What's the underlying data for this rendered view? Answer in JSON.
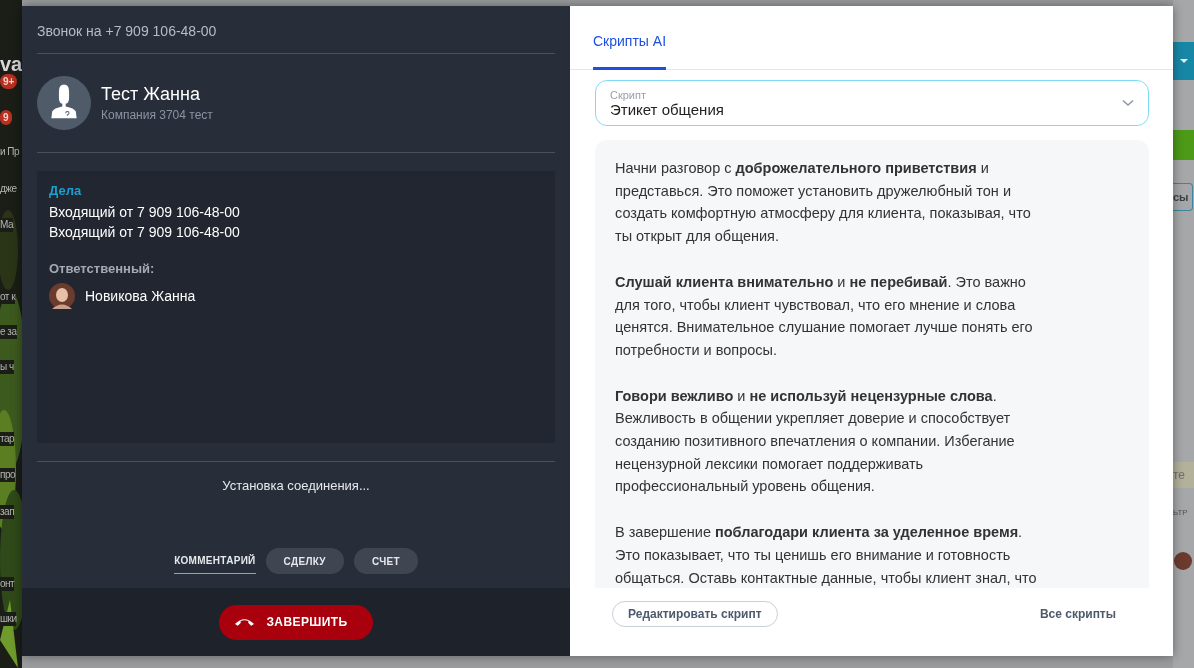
{
  "background": {
    "left": [
      {
        "kind": "logo",
        "text": "va"
      },
      {
        "kind": "badge",
        "text": "9+"
      },
      {
        "kind": "badge",
        "text": "9"
      },
      {
        "kind": "text",
        "text": "и Пр"
      },
      {
        "kind": "text",
        "text": "дже"
      },
      {
        "kind": "text",
        "text": "Ма"
      },
      {
        "kind": "text",
        "text": "от к"
      },
      {
        "kind": "text",
        "text": "е за"
      },
      {
        "kind": "text",
        "text": "ы ч"
      },
      {
        "kind": "text",
        "text": "тар"
      },
      {
        "kind": "text",
        "text": "про"
      },
      {
        "kind": "text",
        "text": "зап"
      },
      {
        "kind": "text",
        "text": "онт"
      },
      {
        "kind": "text",
        "text": "шки"
      }
    ],
    "right": [
      {
        "kind": "dropdown"
      },
      {
        "kind": "green-bar"
      },
      {
        "kind": "button",
        "text": "сы"
      },
      {
        "kind": "text",
        "text": "те"
      },
      {
        "kind": "small",
        "text": "ЬТР"
      },
      {
        "kind": "avatar"
      }
    ]
  },
  "call": {
    "title": "Звонок на +7 909 106-48-00",
    "contact": {
      "name": "Тест Жанна",
      "company": "Компания 3704 тест"
    },
    "deals": {
      "heading": "Дела",
      "items": [
        "Входящий от 7 909 106-48-00",
        "Входящий от 7 909 106-48-00"
      ]
    },
    "responsible": {
      "label": "Ответственный:",
      "name": "Новикова Жанна"
    },
    "status": "Установка соединения...",
    "actions": [
      {
        "label": "КОММЕНТАРИЙ",
        "selected": true
      },
      {
        "label": "СДЕЛКУ",
        "selected": false
      },
      {
        "label": "СЧЕТ",
        "selected": false
      }
    ],
    "end_button": "ЗАВЕРШИТЬ"
  },
  "scripts": {
    "tabs": [
      {
        "label": "Скрипты AI",
        "selected": true
      }
    ],
    "select": {
      "label": "Скрипт",
      "value": "Этикет общения"
    },
    "paragraphs": [
      "Начни разговор с **доброжелательного приветствия** и представься. Это поможет установить дружелюбный тон и создать комфортную атмосферу для клиента, показывая, что ты открыт для общения.",
      "**Слушай клиента внимательно** и **не перебивай**. Это важно для того, чтобы клиент чувствовал, что его мнение и слова ценятся. Внимательное слушание помогает лучше понять его потребности и вопросы.",
      "**Говори вежливо** и **не используй нецензурные слова**. Вежливость в общении укрепляет доверие и способствует созданию позитивного впечатления о компании. Избегание нецензурной лексики помогает поддерживать профессиональный уровень общения.",
      "В завершение **поблагодари клиента за уделенное время**. Это показывает, что ты ценишь его внимание и готовность общаться. Оставь контактные данные, чтобы клиент знал, что"
    ],
    "edit_button": "Редактировать скрипт",
    "all_link": "Все скрипты"
  }
}
